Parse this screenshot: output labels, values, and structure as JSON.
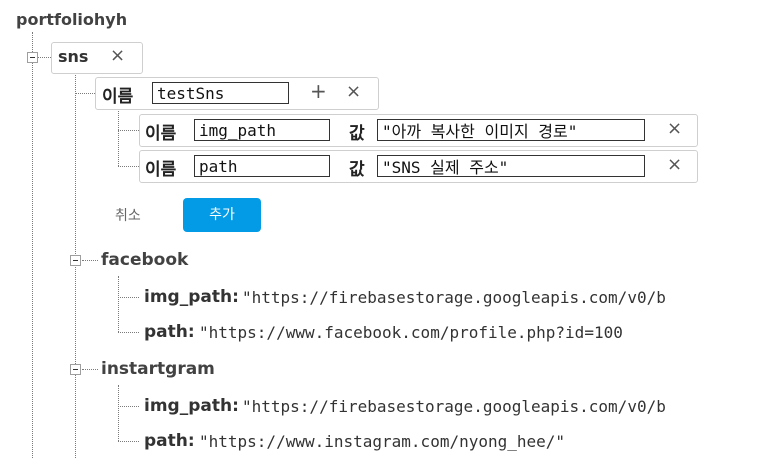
{
  "root": {
    "name": "portfoliohyh"
  },
  "sns": {
    "key": "sns",
    "editor": {
      "name_label": "이름",
      "name_value": "testSns",
      "add_child_symbol": "+",
      "remove_symbol": "×",
      "children": [
        {
          "name_label": "이름",
          "name_value": "img_path",
          "value_label": "값",
          "value_value": "\"아까 복사한 이미지 경로\""
        },
        {
          "name_label": "이름",
          "name_value": "path",
          "value_label": "값",
          "value_value": "\"SNS 실제 주소\""
        }
      ],
      "cancel_label": "취소",
      "add_label": "추가"
    },
    "nodes": [
      {
        "key": "facebook",
        "children": [
          {
            "key": "img_path:",
            "value": "\"https://firebasestorage.googleapis.com/v0/b"
          },
          {
            "key": "path:",
            "value": "\"https://www.facebook.com/profile.php?id=100"
          }
        ]
      },
      {
        "key": "instartgram",
        "children": [
          {
            "key": "img_path:",
            "value": "\"https://firebasestorage.googleapis.com/v0/b"
          },
          {
            "key": "path:",
            "value": "\"https://www.instagram.com/nyong_hee/\""
          }
        ]
      }
    ]
  }
}
